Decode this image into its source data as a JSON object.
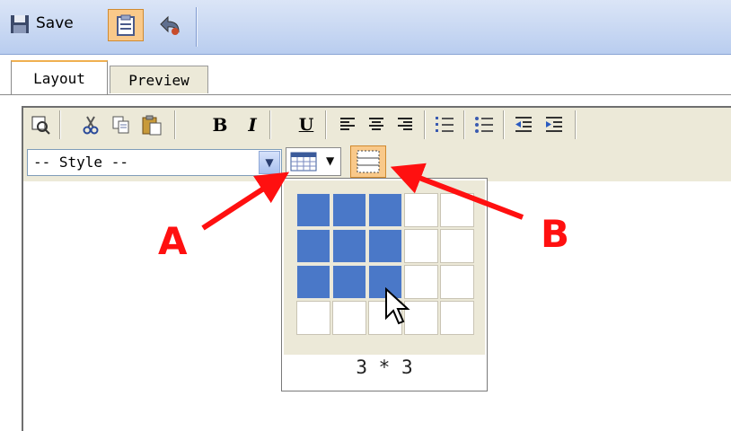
{
  "toolbar": {
    "save_label": "Save",
    "icons": [
      "save-disk-icon",
      "clipboard-icon",
      "undo-icon"
    ]
  },
  "tabs": [
    {
      "label": "Layout",
      "active": true
    },
    {
      "label": "Preview",
      "active": false
    }
  ],
  "format_toolbar": {
    "buttons": [
      "find-icon",
      "cut-icon",
      "copy-icon",
      "paste-icon",
      "bold-icon",
      "italic-icon",
      "underline-icon",
      "align-left-icon",
      "align-center-icon",
      "align-right-icon",
      "ordered-list-icon",
      "unordered-list-icon",
      "outdent-icon",
      "indent-icon"
    ],
    "bold_glyph": "B",
    "italic_glyph": "I",
    "underline_glyph": "U"
  },
  "style_select": {
    "value": "-- Style --"
  },
  "table_picker": {
    "status": "3 * 3",
    "rows": 4,
    "cols": 5,
    "selected_rows": 3,
    "selected_cols": 3
  },
  "annotations": {
    "a": "A",
    "b": "B"
  },
  "colors": {
    "accent_red": "#ff1010",
    "selected_cell": "#4a78c8",
    "active_tab_top": "#f0b050"
  }
}
